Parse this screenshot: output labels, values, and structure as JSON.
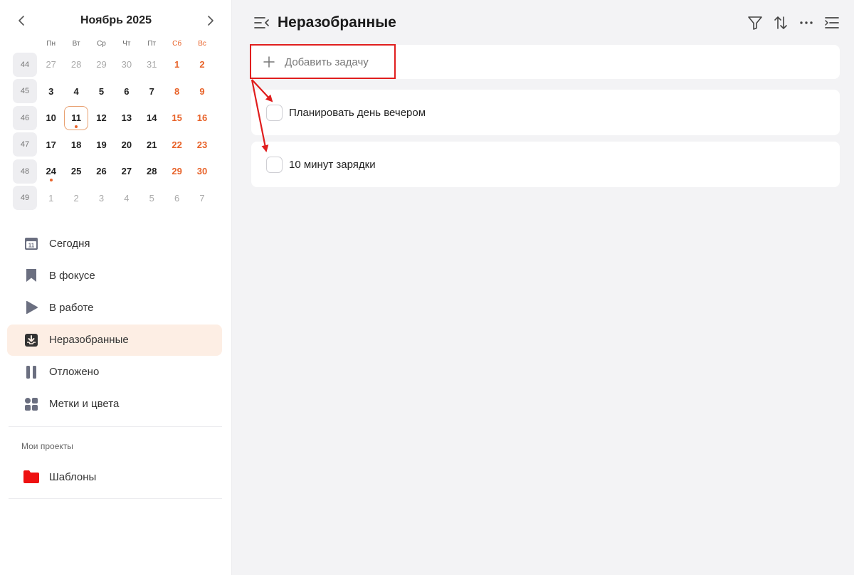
{
  "calendar": {
    "title": "Ноябрь 2025",
    "weekday_headers": [
      "Пн",
      "Вт",
      "Ср",
      "Чт",
      "Пт",
      "Сб",
      "Вс"
    ],
    "weeks": [
      {
        "num": "44",
        "days": [
          "27",
          "28",
          "29",
          "30",
          "31",
          "1",
          "2"
        ]
      },
      {
        "num": "45",
        "days": [
          "3",
          "4",
          "5",
          "6",
          "7",
          "8",
          "9"
        ]
      },
      {
        "num": "46",
        "days": [
          "10",
          "11",
          "12",
          "13",
          "14",
          "15",
          "16"
        ]
      },
      {
        "num": "47",
        "days": [
          "17",
          "18",
          "19",
          "20",
          "21",
          "22",
          "23"
        ]
      },
      {
        "num": "48",
        "days": [
          "24",
          "25",
          "26",
          "27",
          "28",
          "29",
          "30"
        ]
      },
      {
        "num": "49",
        "days": [
          "1",
          "2",
          "3",
          "4",
          "5",
          "6",
          "7"
        ]
      }
    ],
    "today": "11",
    "accent_color": "#e8632a"
  },
  "sidebar": {
    "items": [
      {
        "label": "Сегодня",
        "icon": "calendar-today-icon"
      },
      {
        "label": "В фокусе",
        "icon": "bookmark-icon"
      },
      {
        "label": "В работе",
        "icon": "play-icon"
      },
      {
        "label": "Неразобранные",
        "icon": "inbox-icon",
        "active": true
      },
      {
        "label": "Отложено",
        "icon": "pause-icon"
      },
      {
        "label": "Метки и цвета",
        "icon": "tags-grid-icon"
      }
    ],
    "projects_title": "Мои проекты",
    "projects": [
      {
        "label": "Шаблоны",
        "icon": "folder-icon",
        "color": "#ee1111"
      }
    ],
    "active_bg": "#fdeee4"
  },
  "main": {
    "title": "Неразобранные",
    "toolbar_icons": [
      "filter-icon",
      "sort-icon",
      "more-icon",
      "details-panel-icon"
    ],
    "add_task_label": "Добавить задачу",
    "tasks": [
      {
        "label": "Планировать день вечером",
        "done": false
      },
      {
        "label": "10 минут зарядки",
        "done": false
      }
    ],
    "highlight_color": "#e01e1e"
  }
}
